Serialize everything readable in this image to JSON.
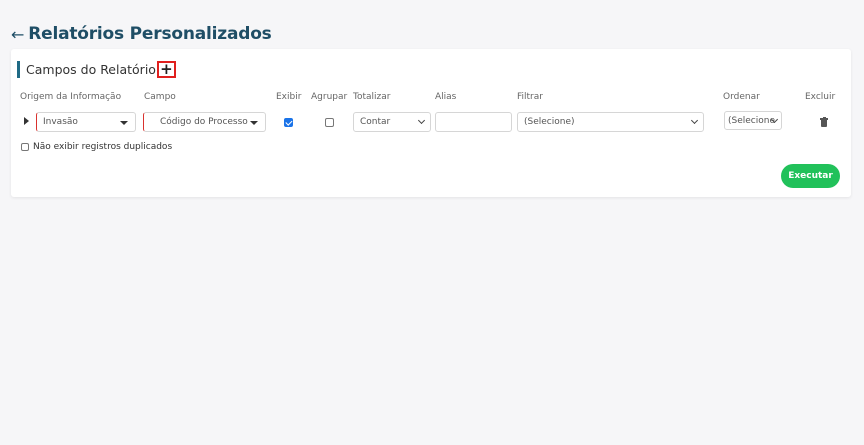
{
  "page": {
    "title": "Relatórios Personalizados",
    "back_icon": "arrow-left-icon"
  },
  "section": {
    "title": "Campos do Relatório",
    "add_label": "+"
  },
  "columns": {
    "origem": "Origem da Informação",
    "campo": "Campo",
    "exibir": "Exibir",
    "agrupar": "Agrupar",
    "totalizar": "Totalizar",
    "alias": "Alias",
    "filtrar": "Filtrar",
    "ordenar": "Ordenar",
    "excluir": "Excluir"
  },
  "row": {
    "origem": "Invasão",
    "campo": "Código do Processo",
    "exibir": true,
    "agrupar": false,
    "totalizar": "Contar",
    "alias": "",
    "filtrar": "(Selecione)",
    "ordenar": "(Selecione"
  },
  "options": {
    "no_duplicates": "Não exibir registros duplicados"
  },
  "actions": {
    "execute": "Executar"
  },
  "colors": {
    "accent": "#1f6a85",
    "title": "#1f4e66",
    "execute": "#21c15a",
    "required": "#d9322e",
    "highlight": "#e0201e"
  }
}
